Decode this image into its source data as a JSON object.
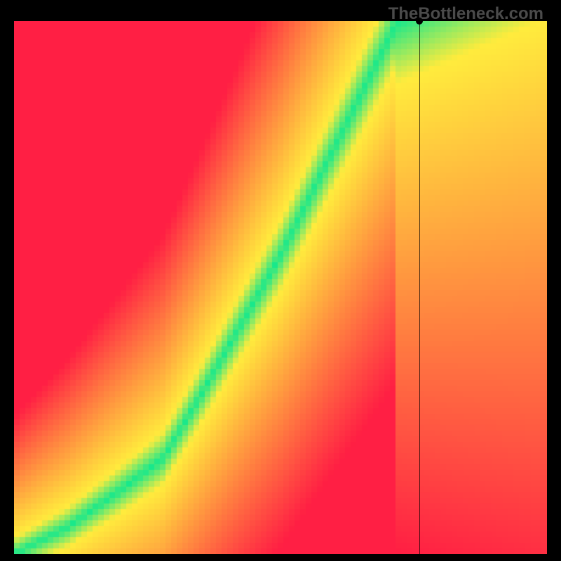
{
  "watermark": "TheBottleneck.com",
  "chart_data": {
    "type": "heatmap",
    "title": "",
    "xlabel": "",
    "ylabel": "",
    "xlim": [
      0,
      100
    ],
    "ylim": [
      0,
      100
    ],
    "colormap": "red-yellow-green (divergent efficiency)",
    "optimal_curve_description": "green optimal band: piecewise curve from (0,0) to (~28,18) shallow, then bending up to (~72,100)",
    "optimal_curve_points": [
      {
        "x": 0,
        "y": 0
      },
      {
        "x": 10,
        "y": 5
      },
      {
        "x": 20,
        "y": 12
      },
      {
        "x": 28,
        "y": 18
      },
      {
        "x": 34,
        "y": 28
      },
      {
        "x": 42,
        "y": 42
      },
      {
        "x": 50,
        "y": 56
      },
      {
        "x": 58,
        "y": 72
      },
      {
        "x": 65,
        "y": 86
      },
      {
        "x": 72,
        "y": 100
      }
    ],
    "vertical_marker_x": 76,
    "grid": false,
    "legend": false
  },
  "colors": {
    "red": "#ff1f44",
    "yellow": "#ffec3d",
    "green": "#17e88c",
    "black": "#000000",
    "watermark": "#4a4a4a"
  }
}
